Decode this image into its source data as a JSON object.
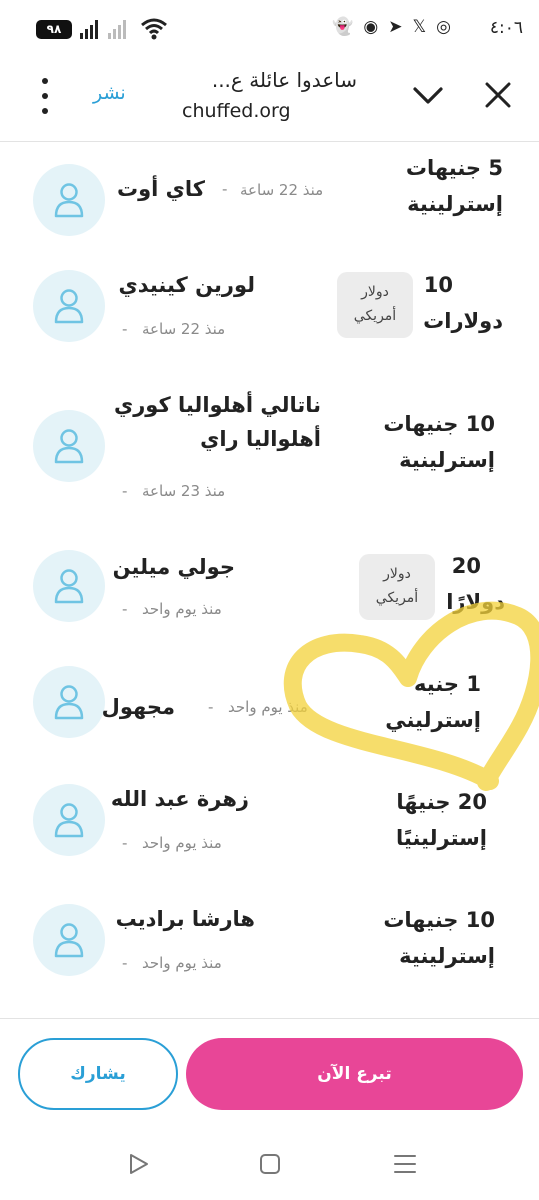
{
  "status_bar": {
    "time": "٤:٠٦",
    "battery": "٩٨"
  },
  "browser": {
    "title": "ساعدوا عائلة ع...",
    "url": "chuffed.org",
    "share_label": "نشر"
  },
  "donations": [
    {
      "name": "كاي أوت",
      "time": "منذ 22 ساعة",
      "amount_line1": "5 جنيهات",
      "amount_line2": "إسترلينية",
      "currency_badge": null
    },
    {
      "name": "لورين كينيدي",
      "time": "منذ 22 ساعة",
      "amount_line1": "10",
      "amount_line2": "دولارات",
      "currency_badge": [
        "دولار",
        "أمريكي"
      ]
    },
    {
      "name_line1": "ناتالي أهلواليا كوري",
      "name_line2": "أهلواليا راي",
      "time": "منذ 23 ساعة",
      "amount_line1": "10 جنيهات",
      "amount_line2": "إسترلينية",
      "currency_badge": null
    },
    {
      "name": "جولي ميلين",
      "time": "منذ يوم واحد",
      "amount_line1": "20",
      "amount_line2": "دولارًا",
      "currency_badge": [
        "دولار",
        "أمريكي"
      ]
    },
    {
      "name": "مجهول",
      "time": "منذ يوم واحد",
      "amount_line1": "1 جنيه",
      "amount_line2": "إسترليني",
      "currency_badge": null
    },
    {
      "name": "زهرة عبد الله",
      "time": "منذ يوم واحد",
      "amount_line1": "20 جنيهًا",
      "amount_line2": "إسترلينيًا",
      "currency_badge": null
    },
    {
      "name": "هارشا براديب",
      "time": "منذ يوم واحد",
      "amount_line1": "10 جنيهات",
      "amount_line2": "إسترلينية",
      "currency_badge": null
    }
  ],
  "actions": {
    "share_button": "يشارك",
    "donate_button": "تبرع الآن"
  },
  "colors": {
    "accent_blue": "#2a9fd6",
    "donate_pink": "#e84697",
    "avatar_bg": "#e4f3f8",
    "heart_scribble": "#f3d23a"
  }
}
